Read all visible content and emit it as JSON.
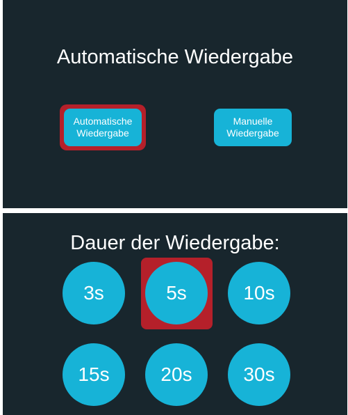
{
  "top_panel": {
    "title": "Automatische Wiedergabe",
    "buttons": [
      {
        "label": "Automatische Wiedergabe",
        "selected": true
      },
      {
        "label": "Manuelle Wiedergabe",
        "selected": false
      }
    ]
  },
  "bottom_panel": {
    "title": "Dauer der Wiedergabe:",
    "options": [
      {
        "label": "3s",
        "selected": false
      },
      {
        "label": "5s",
        "selected": true
      },
      {
        "label": "10s",
        "selected": false
      },
      {
        "label": "15s",
        "selected": false
      },
      {
        "label": "20s",
        "selected": false
      },
      {
        "label": "30s",
        "selected": false
      }
    ]
  },
  "colors": {
    "panel_bg": "#18262d",
    "button_bg": "#17b3d7",
    "selection_frame": "#b5202a",
    "text": "#ffffff"
  }
}
